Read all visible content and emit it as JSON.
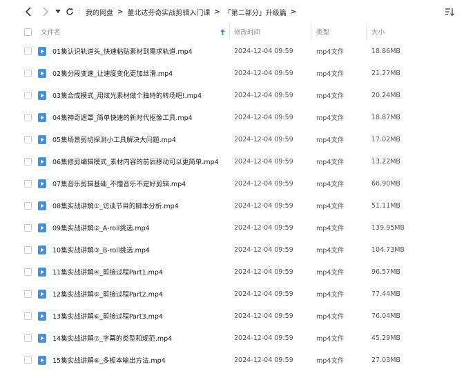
{
  "breadcrumb": [
    {
      "label": "我的网盘"
    },
    {
      "label": "董北达芬奇实战剪辑入门课"
    },
    {
      "label": "「第二部分」升级篇"
    }
  ],
  "columns": {
    "name": "文件名",
    "modified": "修改时间",
    "type": "类型",
    "size": "大小"
  },
  "files": [
    {
      "name": "01集认识轨道头_快速粘贴素材到需求轨道.mp4",
      "modified": "2024-12-04 09:59",
      "type": "mp4文件",
      "size": "18.86MB"
    },
    {
      "name": "02集分段变速_让速度变化更加丝滑.mp4",
      "modified": "2024-12-04 09:59",
      "type": "mp4文件",
      "size": "21.27MB"
    },
    {
      "name": "03集合成模式_用炫光素材做个独特的转场吧!.mp4",
      "modified": "2024-12-04 09:59",
      "type": "mp4文件",
      "size": "20.24MB"
    },
    {
      "name": "04集神奇遮罩_简单快速的新时代抠像工具.mp4",
      "modified": "2024-12-04 09:59",
      "type": "mp4文件",
      "size": "18.87MB"
    },
    {
      "name": "05集场景剪切探测小工具解决大问题.mp4",
      "modified": "2024-12-04 09:59",
      "type": "mp4文件",
      "size": "17.02MB"
    },
    {
      "name": "06集修剪编辑模式_素材内容的前后移动可以更简单.mp4",
      "modified": "2024-12-04 09:59",
      "type": "mp4文件",
      "size": "13.22MB"
    },
    {
      "name": "07集音乐剪辑基础_不懂音乐不是好剪辑.mp4",
      "modified": "2024-12-04 09:59",
      "type": "mp4文件",
      "size": "66.90MB"
    },
    {
      "name": "08集实战讲解①_访谈节目的脚本分析.mp4",
      "modified": "2024-12-04 09:59",
      "type": "mp4文件",
      "size": "51.11MB"
    },
    {
      "name": "09集实战讲解②_A-roll挑选.mp4",
      "modified": "2024-12-04 09:59",
      "type": "mp4文件",
      "size": "139.95MB"
    },
    {
      "name": "10集实战讲解③_B-roll挑选.mp4",
      "modified": "2024-12-04 09:59",
      "type": "mp4文件",
      "size": "104.73MB"
    },
    {
      "name": "11集实战讲解④_剪接过程Part1.mp4",
      "modified": "2024-12-04 09:59",
      "type": "mp4文件",
      "size": "96.57MB"
    },
    {
      "name": "12集实战讲解⑤_剪接过程Part2.mp4",
      "modified": "2024-12-04 09:59",
      "type": "mp4文件",
      "size": "77.44MB"
    },
    {
      "name": "13集实战讲解⑥_剪接过程Part3.mp4",
      "modified": "2024-12-04 09:59",
      "type": "mp4文件",
      "size": "76.04MB"
    },
    {
      "name": "14集实战讲解⑦_字幕的类型和规范.mp4",
      "modified": "2024-12-04 09:59",
      "type": "mp4文件",
      "size": "45.29MB"
    },
    {
      "name": "15集实战讲解⑧_多板本输出方法.mp4",
      "modified": "2024-12-04 09:59",
      "type": "mp4文件",
      "size": "27.03MB"
    }
  ],
  "icons": {
    "back": "chevron-left-icon",
    "forward": "chevron-right-icon",
    "history": "caret-down-icon",
    "refresh": "refresh-icon",
    "sort": "sort-icon",
    "sort_indicator": "arrow-up-icon",
    "file": "video-file-icon"
  },
  "colors": {
    "file_icon": "#4a90e2",
    "header_text": "#8a8f99",
    "sort_arrow": "#3b82f6"
  }
}
